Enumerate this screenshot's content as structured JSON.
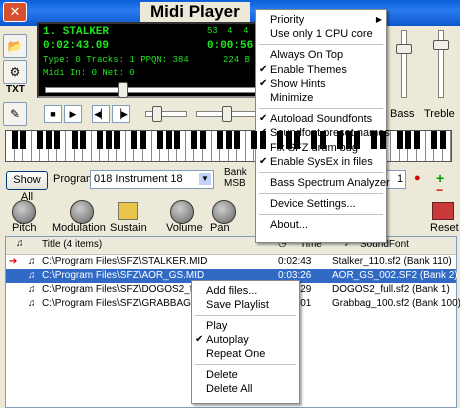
{
  "app": {
    "title": "Midi Player"
  },
  "side": {
    "txt_label": "TXT"
  },
  "lcd": {
    "song": "1. STALKER",
    "elapsed": "0:02:43.09",
    "num1": "53",
    "num2": "4",
    "num3": "4",
    "total": "0:00:56.",
    "type_line": "Type: 0  Tracks: 1  PPQN: 384",
    "kbps": "224 B",
    "midi_line": "Midi In: 0   Net: 0"
  },
  "controls": {
    "show_all": "Show All",
    "program_label": "Program",
    "program_value": "018 Instrument 18",
    "bank_label": "Bank",
    "msb_label": "MSB",
    "bank_value": "1",
    "knobs": [
      "Pitch",
      "Modulation",
      "Sustain",
      "Volume",
      "Pan"
    ],
    "bass_label": "Bass",
    "treble_label": "Treble",
    "reset_label": "Reset"
  },
  "playlist": {
    "header_title": "Title  (4 items)",
    "header_time": "Time",
    "header_soundfont": "SoundFont",
    "rows": [
      {
        "title": "C:\\Program Files\\SFZ\\STALKER.MID",
        "time": "0:02:43",
        "soundfont": "Stalker_110.sf2 (Bank 110)"
      },
      {
        "title": "C:\\Program Files\\SFZ\\AOR_GS.MID",
        "time": "0:03:26",
        "soundfont": "AOR_GS_002.SF2 (Bank 2)"
      },
      {
        "title": "C:\\Program Files\\SFZ\\DOGOS2_full.MID",
        "time": "0:01:29",
        "soundfont": "DOGOS2_full.sf2 (Bank 1)"
      },
      {
        "title": "C:\\Program Files\\SFZ\\GRABBAG.MID",
        "time": "0:01:01",
        "soundfont": "Grabbag_100.sf2 (Bank 100)"
      }
    ]
  },
  "main_menu": {
    "items": [
      {
        "label": "Priority",
        "checked": false,
        "submenu": true
      },
      {
        "label": "Use only 1 CPU core",
        "checked": false
      },
      {
        "sep": true
      },
      {
        "label": "Always On Top",
        "checked": false
      },
      {
        "label": "Enable Themes",
        "checked": true
      },
      {
        "label": "Show Hints",
        "checked": true
      },
      {
        "label": "Minimize",
        "checked": false
      },
      {
        "sep": true
      },
      {
        "label": "Autoload Soundfonts",
        "checked": true
      },
      {
        "label": "Soundfont preset names",
        "checked": true
      },
      {
        "label": "Fix SFZ drum bug",
        "checked": false
      },
      {
        "label": "Enable SysEx in files",
        "checked": true
      },
      {
        "sep": true
      },
      {
        "label": "Bass Spectrum Analyzer",
        "checked": false
      },
      {
        "sep": true
      },
      {
        "label": "Device Settings...",
        "checked": false
      },
      {
        "sep": true
      },
      {
        "label": "About...",
        "checked": false
      }
    ]
  },
  "context_menu": {
    "items": [
      {
        "label": "Add files..."
      },
      {
        "label": "Save Playlist"
      },
      {
        "sep": true
      },
      {
        "label": "Play"
      },
      {
        "label": "Autoplay",
        "checked": true
      },
      {
        "label": "Repeat One"
      },
      {
        "sep": true
      },
      {
        "label": "Delete"
      },
      {
        "label": "Delete All"
      }
    ]
  },
  "colors": {
    "accent": "#316ac5",
    "lcd_text": "#1fe51f",
    "title_bar": "#0a5fd8"
  }
}
